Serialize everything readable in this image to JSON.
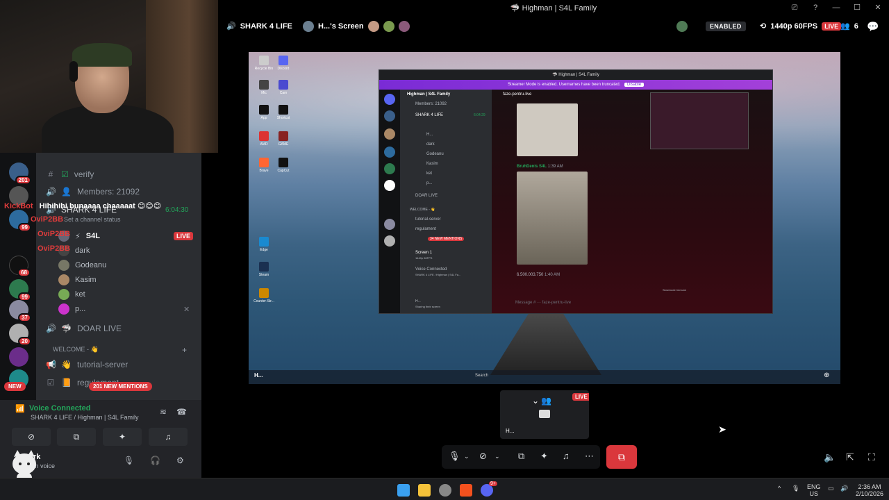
{
  "window": {
    "title": "Highman | S4L Family",
    "controls": [
      "⎚",
      "?",
      "—",
      "☐",
      "✕"
    ]
  },
  "stream_header": {
    "server": "SHARK 4 LIFE",
    "screen": "H...'s Screen",
    "enabled": "ENABLED",
    "quality": "1440p 60FPS",
    "live": "LIVE",
    "viewers": "6"
  },
  "left_channels": {
    "verify": "verify",
    "members": "Members: 21092",
    "voice_channel": "SHARK 4 LIFE",
    "voice_time": "6:04:30",
    "channel_status": "Set a channel status",
    "s4l_tag": "S4L",
    "live_badge": "LIVE",
    "member_dark": "dark",
    "member_godeanu": "Godeanu",
    "member_kasim": "Kasim",
    "member_ket": "ket",
    "member_p": "p...",
    "doar_live": "DOAR LIVE",
    "welcome": "WELCOME - 👋",
    "tutorial": "tutorial-server",
    "regulament": "regulament",
    "mentions": "201 NEW MENTIONS",
    "new_badge": "NEW"
  },
  "chat_overlay": {
    "kickbot": "KickBot",
    "kickbot_msg": "Hihihihi bunaaaa chaaaaat 😊😊😊",
    "user1": "OviP2BB",
    "user2": "OviP2BB",
    "user3": "OviP2BB"
  },
  "server_counts": [
    "201",
    "99",
    "68",
    "99",
    "37",
    "20"
  ],
  "voice": {
    "connected": "Voice Connected",
    "location": "SHARK 4 LIFE / Highman | S4L Family",
    "user": "rk",
    "status": "In voice"
  },
  "nested": {
    "title": "Highman | S4L Family",
    "streamer_bar": "Streamer Mode is enabled. Usernames have been truncated.",
    "disable": "Disable",
    "server": "Highman | S4L Family",
    "members": "Members: 21092",
    "channel": "faze-pentru-live",
    "voice": "SHARK 4 LIFE",
    "time": "6:04:29",
    "users": [
      "H...",
      "dark",
      "Godeanu",
      "Kasim",
      "ket",
      "p..."
    ],
    "doar": "DOAR LIVE",
    "welcome": "WELCOME - 👋",
    "tutorial": "tutorial-server",
    "regulament": "regulament",
    "mentions": "34 NEW MENTIONS",
    "screen": "Screen 1",
    "screen_res": "1440p 60FPS",
    "voice_connected": "Voice Connected",
    "voice_loc": "SHARK 4 LIFE / Highman | S4L Fa...",
    "sharing": "Sharing their screen",
    "author": "BruhDenis",
    "author_tag": "S4L",
    "time1": "1:39 AM",
    "author2": "6.500.003.750",
    "time2": "1:40 AM",
    "message_placeholder": "Message # ··· faze-pentru-live",
    "slowmode": "Slowmode Immune"
  },
  "desktop_icons": [
    "Recycle Bin",
    "Discord",
    "Mic",
    "Cam",
    "App",
    "Shortcut",
    "AMD",
    "GAME",
    "Brave",
    "CapCut",
    "Edge",
    "Steam",
    "Counter-Str..."
  ],
  "desktop_search": "Search",
  "desktop_taskbar_label": "H...",
  "pip": {
    "live": "LIVE",
    "label": "H..."
  },
  "taskbar": {
    "lang1": "ENG",
    "lang2": "US",
    "time": "2:36 AM",
    "date": "2/10/2026",
    "notif": "9+"
  },
  "colors": {
    "accent": "#5865f2",
    "danger": "#da373c",
    "online": "#23a55a"
  }
}
